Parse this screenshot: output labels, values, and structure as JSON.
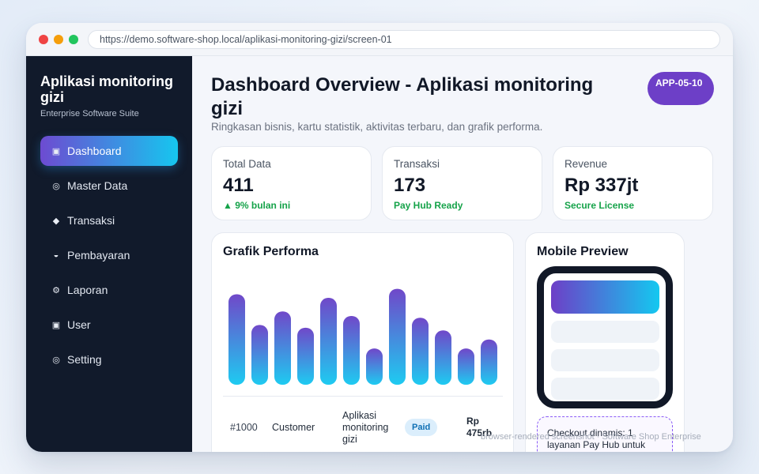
{
  "browser": {
    "url": "https://demo.software-shop.local/aplikasi-monitoring-gizi/screen-01"
  },
  "sidebar": {
    "brand_title": "Aplikasi monitoring gizi",
    "brand_subtitle": "Enterprise Software Suite",
    "items": [
      {
        "icon": "▣",
        "label": "Dashboard",
        "active": true
      },
      {
        "icon": "◎",
        "label": "Master Data"
      },
      {
        "icon": "◆",
        "label": "Transaksi"
      },
      {
        "icon": "◒",
        "label": "Pembayaran"
      },
      {
        "icon": "⚙",
        "label": "Laporan"
      },
      {
        "icon": "▣",
        "label": "User"
      },
      {
        "icon": "◎",
        "label": "Setting"
      }
    ]
  },
  "header": {
    "title": "Dashboard Overview - Aplikasi monitoring gizi",
    "subtitle": "Ringkasan bisnis, kartu statistik, aktivitas terbaru, dan grafik performa.",
    "badge": "APP-05-10"
  },
  "stats": [
    {
      "label": "Total Data",
      "value": "411",
      "note": "▲ 9% bulan ini"
    },
    {
      "label": "Transaksi",
      "value": "173",
      "note": "Pay Hub Ready"
    },
    {
      "label": "Revenue",
      "value": "Rp 337jt",
      "note": "Secure License"
    }
  ],
  "chart": {
    "title": "Grafik Performa"
  },
  "chart_data": {
    "type": "bar",
    "values": [
      100,
      66,
      81,
      63,
      96,
      76,
      40,
      106,
      74,
      60,
      40,
      50
    ],
    "ylim": [
      0,
      110
    ],
    "grid": false,
    "legend": "none"
  },
  "table": {
    "rows": [
      {
        "id": "#1000",
        "customer": "Customer",
        "app": "Aplikasi monitoring gizi",
        "status": "Paid",
        "amount": "Rp 475rb"
      }
    ]
  },
  "mobile": {
    "title": "Mobile Preview",
    "checkout_text": "Checkout dinamis: 1 layanan Pay Hub untuk"
  },
  "watermark": "browser-rendered screenshot · Software Shop Enterprise",
  "colors": {
    "accent_start": "#6d4bd1",
    "accent_end": "#16c6ef",
    "bar_top": "#7048c9",
    "bar_bottom": "#1ecbf1",
    "sidebar_bg": "#111a2b",
    "success": "#16a34a"
  }
}
